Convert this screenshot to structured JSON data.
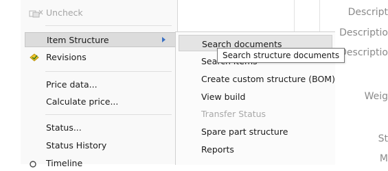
{
  "background": {
    "labels": [
      "Descript",
      "Descriptio",
      "Descriptio",
      "Weig",
      "St",
      "M"
    ]
  },
  "context_menu": {
    "uncheck": "Uncheck",
    "item_structure": "Item Structure",
    "revisions": "Revisions",
    "price_data": "Price data...",
    "calculate_price": "Calculate price...",
    "status": "Status...",
    "status_history": "Status History",
    "timeline": "Timeline"
  },
  "submenu": {
    "search_documents": "Search documents",
    "search_items": "Search items",
    "create_custom_structure": "Create custom structure (BOM)",
    "view_build": "View build",
    "transfer_status": "Transfer Status",
    "spare_part_structure": "Spare part structure",
    "reports": "Reports"
  },
  "tooltip": {
    "text": "Search structure documents"
  },
  "colors": {
    "accent": "#3a6fc2",
    "disabled_text": "#a5a5a5"
  }
}
